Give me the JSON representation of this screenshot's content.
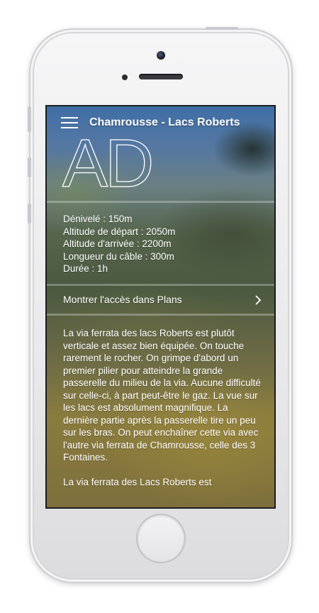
{
  "nav": {
    "title": "Chamrousse - Lacs Roberts"
  },
  "route": {
    "grade": "AD",
    "stats": [
      "Dénivelé : 150m",
      "Altitude de départ : 2050m",
      "Altitude d'arrivée : 2200m",
      "Longueur du câble : 300m",
      "Durée : 1h"
    ],
    "maps_link": "Montrer l'accès dans Plans",
    "description": [
      "La via ferrata des lacs Roberts est plutôt verticale et assez bien équipée. On touche rarement le rocher. On grimpe d'abord un premier pilier pour atteindre la grande passerelle du milieu de la via. Aucune difficulté sur celle-ci, à part peut-être le gaz. La vue sur les lacs est absolument magnifique. La dernière partie après la passerelle tire un peu sur les bras. On peut enchaîner cette via avec l'autre via ferrata de Chamrousse, celle des 3 Fontaines.",
      "La via ferrata des Lacs Roberts est"
    ]
  },
  "icons": {
    "menu": "hamburger-icon",
    "chevron": "chevron-right-icon"
  },
  "colors": {
    "text": "#ffffff",
    "phone_body": "#f2f2f4",
    "sky": "#3f6ea6"
  }
}
